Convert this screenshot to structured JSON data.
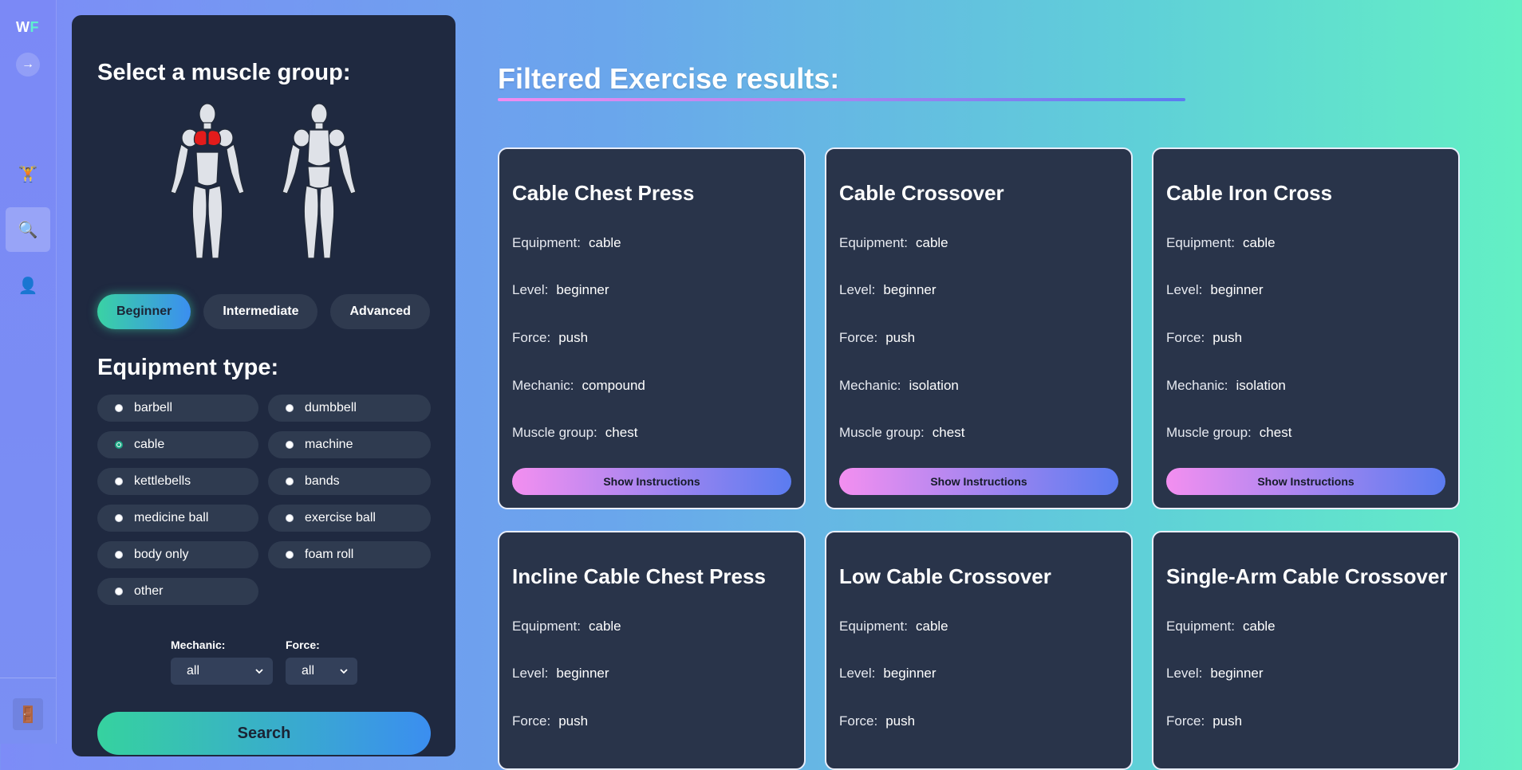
{
  "app": {
    "logo_w": "W",
    "logo_f": "F"
  },
  "rail": {
    "toggle_icon": "→",
    "items": [
      {
        "name": "workout",
        "icon": "🏋"
      },
      {
        "name": "search",
        "icon": "🔍"
      },
      {
        "name": "profile",
        "icon": "👤"
      }
    ],
    "logout_icon": "🚪"
  },
  "filters": {
    "muscle_title": "Select a muscle group:",
    "selected_muscle": "chest",
    "levels": [
      {
        "label": "Beginner",
        "active": true
      },
      {
        "label": "Intermediate",
        "active": false
      },
      {
        "label": "Advanced",
        "active": false
      }
    ],
    "equipment_title": "Equipment type:",
    "equipment": [
      {
        "label": "barbell",
        "checked": false
      },
      {
        "label": "dumbbell",
        "checked": false
      },
      {
        "label": "cable",
        "checked": true
      },
      {
        "label": "machine",
        "checked": false
      },
      {
        "label": "kettlebells",
        "checked": false
      },
      {
        "label": "bands",
        "checked": false
      },
      {
        "label": "medicine ball",
        "checked": false
      },
      {
        "label": "exercise ball",
        "checked": false
      },
      {
        "label": "body only",
        "checked": false
      },
      {
        "label": "foam roll",
        "checked": false
      },
      {
        "label": "other",
        "checked": false
      }
    ],
    "mechanic_label": "Mechanic:",
    "mechanic_value": "all",
    "force_label": "Force:",
    "force_value": "all",
    "search_label": "Search"
  },
  "results": {
    "title": "Filtered Exercise results:",
    "labels": {
      "equipment": "Equipment:",
      "level": "Level:",
      "force": "Force:",
      "mechanic": "Mechanic:",
      "muscle": "Muscle group:"
    },
    "button_label": "Show Instructions",
    "cards": [
      {
        "name": "Cable Chest Press",
        "equipment": "cable",
        "level": "beginner",
        "force": "push",
        "mechanic": "compound",
        "muscle": "chest"
      },
      {
        "name": "Cable Crossover",
        "equipment": "cable",
        "level": "beginner",
        "force": "push",
        "mechanic": "isolation",
        "muscle": "chest"
      },
      {
        "name": "Cable Iron Cross",
        "equipment": "cable",
        "level": "beginner",
        "force": "push",
        "mechanic": "isolation",
        "muscle": "chest"
      },
      {
        "name": "Incline Cable Chest Press",
        "equipment": "cable",
        "level": "beginner",
        "force": "push"
      },
      {
        "name": "Low Cable Crossover",
        "equipment": "cable",
        "level": "beginner",
        "force": "push"
      },
      {
        "name": "Single-Arm Cable Crossover",
        "equipment": "cable",
        "level": "beginner",
        "force": "push"
      }
    ]
  },
  "colors": {
    "panel": "#1f2940",
    "card": "#29344a",
    "accent_green": "#36d29f",
    "accent_blue": "#3b8ef0",
    "accent_pink": "#f38ff0",
    "muscle_highlight": "#e31b1b"
  }
}
